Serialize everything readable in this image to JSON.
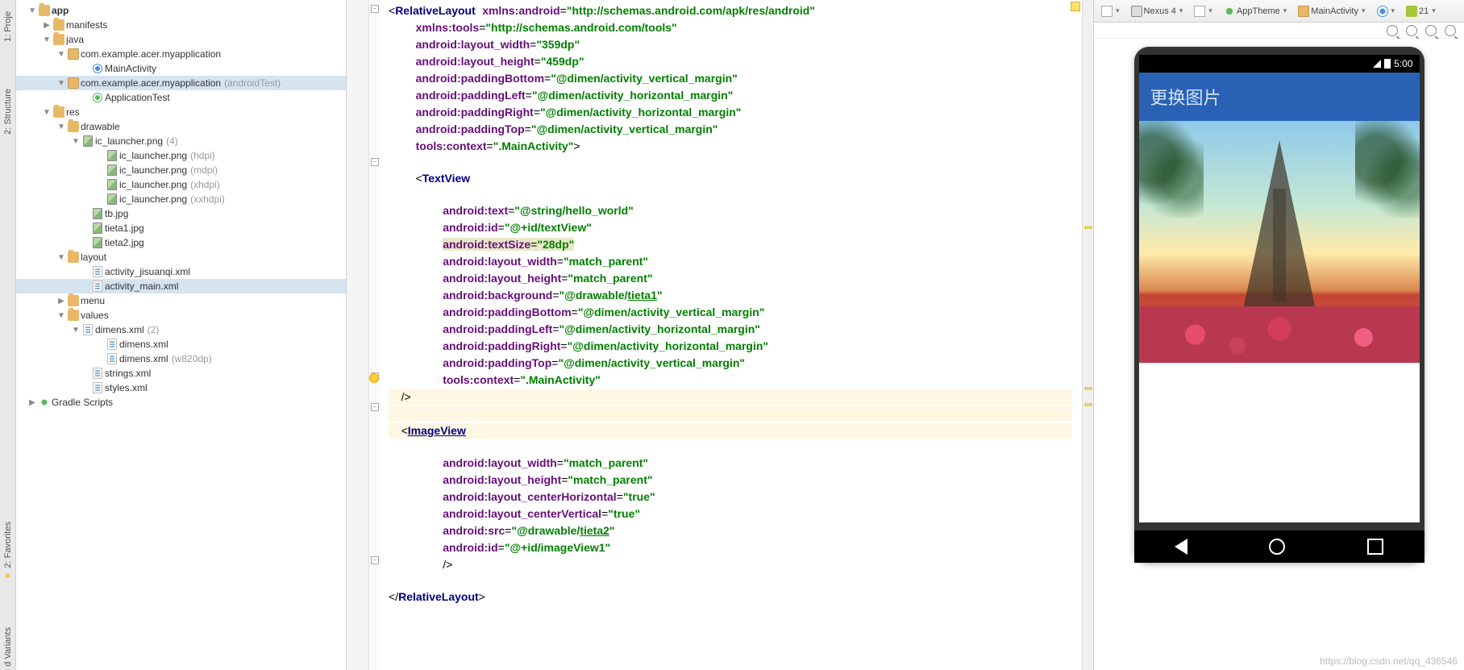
{
  "sideTabs": {
    "t1": "1: Proje",
    "t2": "2: Structure",
    "t3": "2: Favorites",
    "t4": "d Variants"
  },
  "tree": {
    "app": "app",
    "manifests": "manifests",
    "java": "java",
    "pkg1": "com.example.acer.myapplication",
    "mainActivity": "MainActivity",
    "pkg2": "com.example.acer.myapplication",
    "pkg2Hint": "(androidTest)",
    "appTest": "ApplicationTest",
    "res": "res",
    "drawable": "drawable",
    "icLauncher": "ic_launcher.png",
    "icLauncherHint": "(4)",
    "icH": "ic_launcher.png",
    "icHh": "(hdpi)",
    "icM": "ic_launcher.png",
    "icMh": "(mdpi)",
    "icX": "ic_launcher.png",
    "icXh": "(xhdpi)",
    "icXX": "ic_launcher.png",
    "icXXh": "(xxhdpi)",
    "tb": "tb.jpg",
    "tieta1": "tieta1.jpg",
    "tieta2": "tieta2.jpg",
    "layout": "layout",
    "actJi": "activity_jisuanqi.xml",
    "actMain": "activity_main.xml",
    "menu": "menu",
    "values": "values",
    "dimens": "dimens.xml",
    "dimensHint": "(2)",
    "dimens1": "dimens.xml",
    "dimens2": "dimens.xml",
    "dimens2Hint": "(w820dp)",
    "strings": "strings.xml",
    "styles": "styles.xml",
    "gradle": "Gradle Scripts"
  },
  "code": {
    "l1a": "RelativeLayout",
    "l1b": "xmlns:",
    "l1c": "android",
    "l1d": "\"http://schemas.android.com/apk/res/android\"",
    "l2a": "xmlns:",
    "l2b": "tools",
    "l2c": "\"http://schemas.android.com/tools\"",
    "l3a": "android:",
    "l3b": "layout_width",
    "l3c": "\"359dp\"",
    "l4a": "android:",
    "l4b": "layout_height",
    "l4c": "\"459dp\"",
    "l5a": "android:",
    "l5b": "paddingBottom",
    "l5c": "\"@dimen/activity_vertical_margin\"",
    "l6a": "android:",
    "l6b": "paddingLeft",
    "l6c": "\"@dimen/activity_horizontal_margin\"",
    "l7a": "android:",
    "l7b": "paddingRight",
    "l7c": "\"@dimen/activity_horizontal_margin\"",
    "l8a": "android:",
    "l8b": "paddingTop",
    "l8c": "\"@dimen/activity_vertical_margin\"",
    "l9a": "tools:",
    "l9b": "context",
    "l9c": "\".MainActivity\"",
    "tv": "TextView",
    "t1a": "android:",
    "t1b": "text",
    "t1c": "\"@string/hello_world\"",
    "t2a": "android:",
    "t2b": "id",
    "t2c": "\"@+id/textView\"",
    "t3a": "android:",
    "t3b": "textSize",
    "t3c": "\"28dp\"",
    "t4a": "android:",
    "t4b": "layout_width",
    "t4c": "\"match_parent\"",
    "t5a": "android:",
    "t5b": "layout_height",
    "t5c": "\"match_parent\"",
    "t6a": "android:",
    "t6b": "background",
    "t6va": "\"@drawable/",
    "t6vb": "tieta1",
    "t6vc": "\"",
    "t7a": "android:",
    "t7b": "paddingBottom",
    "t7c": "\"@dimen/activity_vertical_margin\"",
    "t8a": "android:",
    "t8b": "paddingLeft",
    "t8c": "\"@dimen/activity_horizontal_margin\"",
    "t9a": "android:",
    "t9b": "paddingRight",
    "t9c": "\"@dimen/activity_horizontal_margin\"",
    "t10a": "android:",
    "t10b": "paddingTop",
    "t10c": "\"@dimen/activity_vertical_margin\"",
    "t11a": "tools:",
    "t11b": "context",
    "t11c": "\".MainActivity\"",
    "iv": "ImageView",
    "i1a": "android:",
    "i1b": "layout_width",
    "i1c": "\"match_parent\"",
    "i2a": "android:",
    "i2b": "layout_height",
    "i2c": "\"match_parent\"",
    "i3a": "android:",
    "i3b": "layout_centerHorizontal",
    "i3c": "\"true\"",
    "i4a": "android:",
    "i4b": "layout_centerVertical",
    "i4c": "\"true\"",
    "i5a": "android:",
    "i5b": "src",
    "i5va": "\"@drawable/",
    "i5vb": "tieta2",
    "i5vc": "\"",
    "i6a": "android:",
    "i6b": "id",
    "i6c": "\"@+id/imageView1\"",
    "closeRL": "RelativeLayout"
  },
  "toolbar": {
    "device": "Nexus 4",
    "theme": "AppTheme",
    "activity": "MainActivity",
    "api": "21"
  },
  "phone": {
    "time": "5:00",
    "title": "更换图片"
  },
  "watermark": "https://blog.csdn.net/qq_436546"
}
